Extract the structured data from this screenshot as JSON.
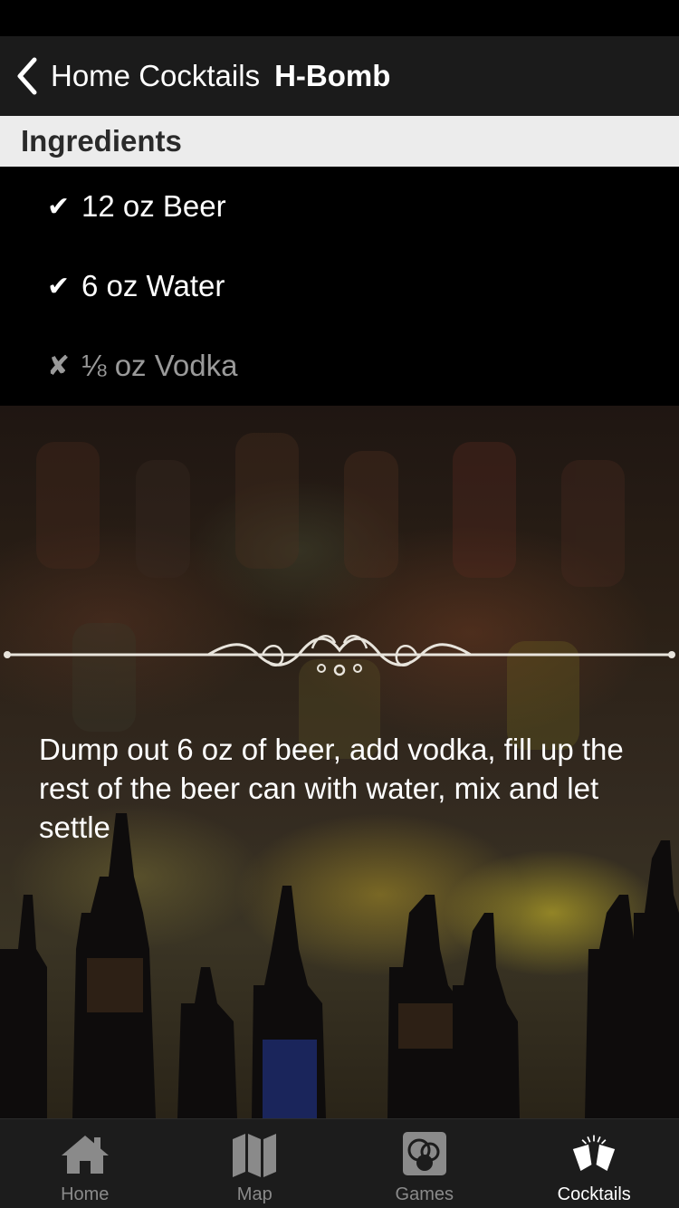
{
  "nav": {
    "back_label": "Home Cocktails",
    "title": "H-Bomb"
  },
  "section": {
    "ingredients_header": "Ingredients"
  },
  "ingredients": [
    {
      "mark": "✔",
      "text": "12 oz Beer",
      "available": true
    },
    {
      "mark": "✔",
      "text": "6 oz Water",
      "available": true
    },
    {
      "mark": "✘",
      "text": "⅛ oz Vodka",
      "available": false
    }
  ],
  "instructions": "Dump out 6 oz of beer, add vodka, fill up the rest of the beer can with water, mix and let settle",
  "tabs": [
    {
      "label": "Home",
      "icon": "house-icon",
      "active": false
    },
    {
      "label": "Map",
      "icon": "map-icon",
      "active": false
    },
    {
      "label": "Games",
      "icon": "games-icon",
      "active": false
    },
    {
      "label": "Cocktails",
      "icon": "cocktail-glasses-icon",
      "active": true
    }
  ],
  "colors": {
    "nav_background": "#1b1b1b",
    "section_header_background": "#ececec",
    "tab_bar_background": "#1c1c1c",
    "tab_inactive": "#8a8a8a",
    "tab_active": "#ffffff",
    "unavailable_ingredient": "#9a9a9a"
  }
}
